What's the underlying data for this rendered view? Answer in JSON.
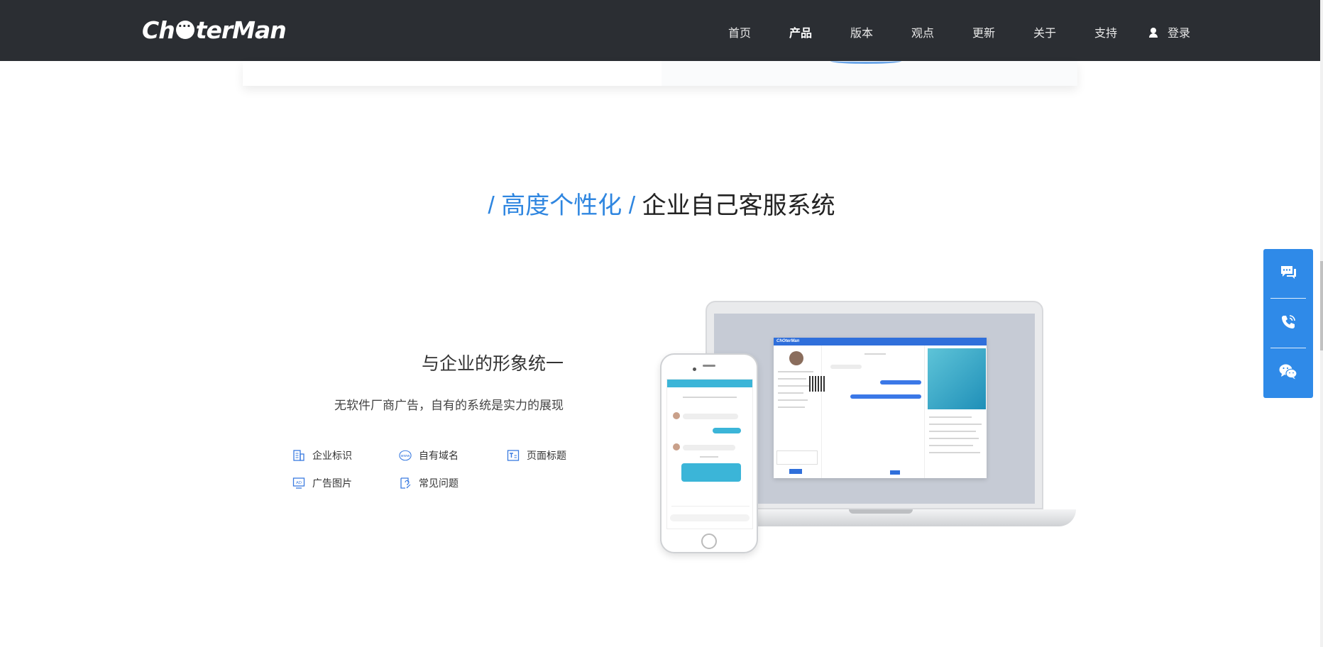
{
  "header": {
    "logo_text": "ChOterMan",
    "nav": [
      {
        "label": "首页"
      },
      {
        "label": "产品"
      },
      {
        "label": "版本"
      },
      {
        "label": "观点"
      },
      {
        "label": "更新"
      },
      {
        "label": "关于"
      },
      {
        "label": "支持"
      }
    ],
    "login_label": "登录"
  },
  "section": {
    "title_slash_1": "/",
    "title_accent": "高度个性化",
    "title_slash_2": "/",
    "title_main": "企业自己客服系统"
  },
  "feature": {
    "title": "与企业的形象统一",
    "description": "无软件厂商广告，自有的系统是实力的展现",
    "items": [
      {
        "label": "企业标识",
        "icon": "building-icon"
      },
      {
        "label": "自有域名",
        "icon": "www-icon"
      },
      {
        "label": "页面标题",
        "icon": "page-title-icon"
      },
      {
        "label": "广告图片",
        "icon": "ad-image-icon"
      },
      {
        "label": "常见问题",
        "icon": "faq-icon"
      }
    ]
  },
  "floating_bar": {
    "buttons": [
      {
        "icon": "chat-bubble-icon"
      },
      {
        "icon": "phone-icon"
      },
      {
        "icon": "wechat-icon"
      }
    ]
  },
  "colors": {
    "header_bg": "#2b2e33",
    "accent": "#2f86e0",
    "float_bar": "#2f8ae8"
  }
}
